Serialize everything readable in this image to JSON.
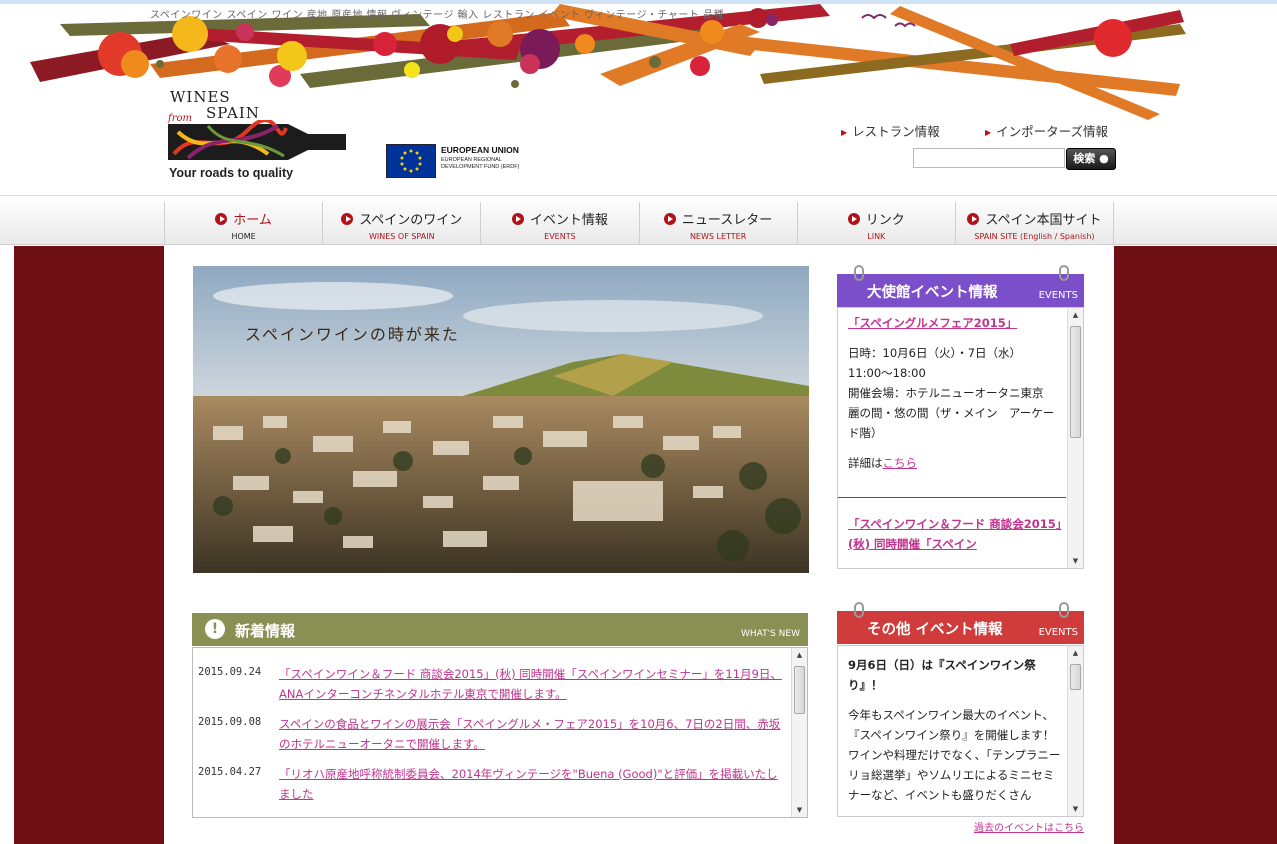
{
  "banner": {
    "tagline": "スペインワイン スペイン ワイン 産地 原産地 情報 ヴィンテージ 輸入 レストラン イベント ヴィンテージ・チャート 品種"
  },
  "logo": {
    "wines": "WINES",
    "from": "from",
    "spain": "SPAIN",
    "slogan": "Your roads to quality"
  },
  "eu": {
    "title": "EUROPEAN UNION",
    "subtitle": "EUROPEAN REGIONAL DEVELOPMENT FUND (ERDF)"
  },
  "header_links": {
    "restaurant": "レストラン情報",
    "importers": "インポーターズ情報"
  },
  "search": {
    "placeholder": "",
    "button": "検索"
  },
  "nav": [
    {
      "label": "ホーム",
      "sub": "HOME"
    },
    {
      "label": "スペインのワイン",
      "sub": "WINES OF SPAIN"
    },
    {
      "label": "イベント情報",
      "sub": "EVENTS"
    },
    {
      "label": "ニュースレター",
      "sub": "NEWS LETTER"
    },
    {
      "label": "リンク",
      "sub": "LINK"
    },
    {
      "label": "スペイン本国サイト",
      "sub": "SPAIN SITE (English / Spanish)"
    }
  ],
  "hero": {
    "caption": "スペインワインの時が来た"
  },
  "news": {
    "title": "新着情報",
    "title_en": "WHAT'S NEW",
    "items": [
      {
        "date": "2015.09.24",
        "text": "「スペインワイン＆フード 商談会2015」(秋) 同時開催「スペインワインセミナー」を11月9日、ANAインターコンチネンタルホテル東京で開催します。"
      },
      {
        "date": "2015.09.08",
        "text": "スペインの食品とワインの展示会「スペイングルメ・フェア2015」を10月6、7日の2日間、赤坂のホテルニューオータニで開催します。"
      },
      {
        "date": "2015.04.27",
        "text": "「リオハ原産地呼称統制委員会、2014年ヴィンテージを\"Buena (Good)\"と評価」を掲載いたしました"
      }
    ]
  },
  "embassy_events": {
    "title": "大使館イベント情報",
    "title_en": "EVENTS",
    "heading1": "「スペイングルメフェア2015」",
    "line_date": "日時：10月6日（火）・7日（水）",
    "line_time": "11:00〜18:00",
    "line_venue": "開催会場：ホテルニューオータニ東京　麗の間・悠の間（ザ・メイン　アーケード階）",
    "detail_prefix": "詳細は",
    "detail_link": "こちら",
    "heading2": "「スペインワイン＆フード 商談会2015」(秋) 同時開催「スペイン"
  },
  "other_events": {
    "title": "その他 イベント情報",
    "title_en": "EVENTS",
    "heading": "9月6日（日）は『スペインワイン祭り』！",
    "body": "今年もスペインワイン最大のイベント、『スペインワイン祭り』を開催します！ワインや料理だけでなく、「テンプラニーリョ総選挙」やソムリエによるミニセミナーなど、イベントも盛りだくさん",
    "past_link": "過去のイベントはこちら"
  },
  "colors": {
    "brand_red": "#b0141b",
    "maroon": "#6e0f16",
    "olive": "#8a8f54",
    "purple": "#7b4fc9",
    "red_panel": "#d03c3c",
    "link_pink": "#c2338e"
  }
}
